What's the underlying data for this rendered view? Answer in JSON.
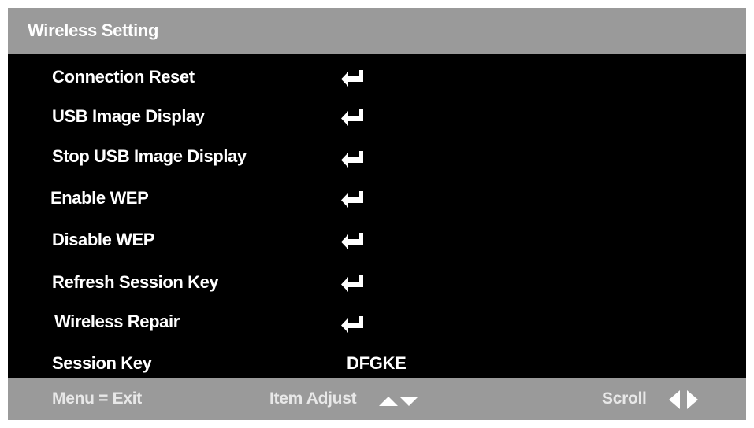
{
  "title": "Wireless Setting",
  "items": [
    {
      "label": "Connection Reset",
      "control": "enter-icon"
    },
    {
      "label": "USB Image Display",
      "control": "enter-icon"
    },
    {
      "label": "Stop USB Image Display",
      "control": "enter-icon"
    },
    {
      "label": "Enable WEP",
      "control": "enter-icon"
    },
    {
      "label": "Disable WEP",
      "control": "enter-icon"
    },
    {
      "label": "Refresh Session Key",
      "control": "enter-icon"
    },
    {
      "label": "Wireless Repair",
      "control": "enter-icon"
    },
    {
      "label": "Session Key",
      "value": "DFGKE"
    }
  ],
  "footer": {
    "exit": "Menu = Exit",
    "adjust": "Item Adjust",
    "adjust_icons": [
      "triangle-up-icon",
      "triangle-down-icon"
    ],
    "scroll": "Scroll",
    "scroll_icons": [
      "triangle-left-icon",
      "triangle-right-icon"
    ]
  },
  "colors": {
    "bar": "#9a9a9a",
    "background": "#000000",
    "text": "#ffffff",
    "footer_text": "#e8e8e8"
  }
}
